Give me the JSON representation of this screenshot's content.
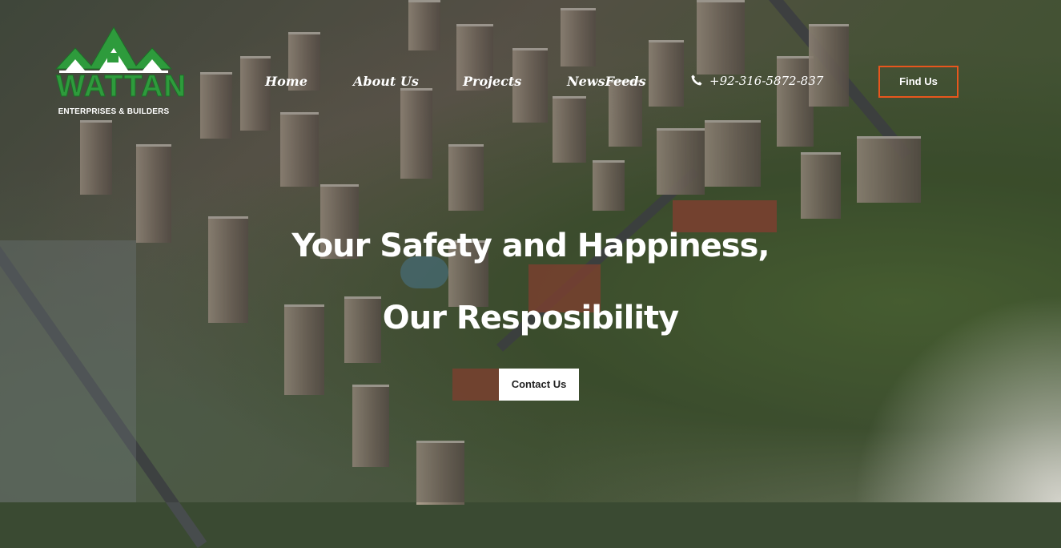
{
  "brand": {
    "logo_word": "WATTAN",
    "logo_subtitle": "ENTERPRISES & BUILDERS",
    "logo_colors": {
      "green": "#2e9b3c",
      "dark_green": "#1e6e28",
      "house": "#ffffff"
    }
  },
  "nav": {
    "items": [
      {
        "label": "Home"
      },
      {
        "label": "About Us"
      },
      {
        "label": "Projects"
      },
      {
        "label": "NewsFeeds"
      }
    ],
    "phone": "+92-316-5872-837",
    "find_us": "Find Us",
    "accent_color": "#e8561d"
  },
  "hero": {
    "line1": "Your Safety and Happiness,",
    "line2": "Our Resposibility",
    "cta": "Contact Us"
  }
}
